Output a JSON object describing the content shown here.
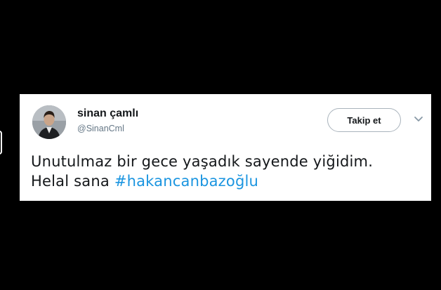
{
  "tweet": {
    "display_name": "sinan çamlı",
    "handle": "@SinanCml",
    "follow_label": "Takip et",
    "text_line1": "Unutulmaz bir gece yaşadık sayende yiğidim.",
    "text_line2_prefix": "Helal sana",
    "hashtag": "#hakancanbazoğlu",
    "menu_icon": "chevron-down-icon",
    "avatar_icon": "avatar"
  },
  "colors": {
    "background": "#000000",
    "card": "#ffffff",
    "text": "#14171a",
    "secondary_text": "#657786",
    "hashtag": "#1b95e0",
    "button_border": "#a9b3bc"
  }
}
